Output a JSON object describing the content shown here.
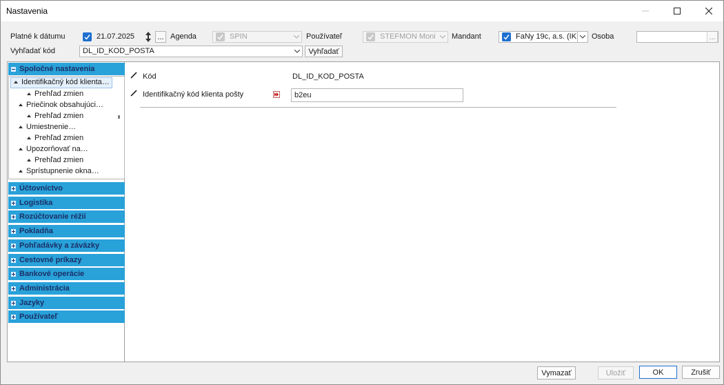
{
  "window": {
    "title": "Nastavenia"
  },
  "filters": {
    "platne_label": "Platné k dátumu",
    "date_value": "21.07.2025",
    "ellipsis": "...",
    "agenda_label": "Agenda",
    "agenda_value": "SPIN",
    "pouzivatel_label": "Používateľ",
    "pouzivatel_value": "STEFMON Moni",
    "mandant_label": "Mandant",
    "mandant_value": "FaNy 19c, a.s. (IK",
    "osoba_label": "Osoba",
    "osoba_value": "",
    "search_label": "Vyhľadať kód",
    "search_value": "DL_ID_KOD_POSTA",
    "search_button": "Vyhľadať"
  },
  "sidebar": {
    "main_group": "Spoločné nastavenia",
    "tree": [
      {
        "label": "Identifikačný kód klienta…",
        "level": 0,
        "selected": true
      },
      {
        "label": "Prehľad zmien",
        "level": 1
      },
      {
        "label": "Priečinok obsahujúci…",
        "level": 0
      },
      {
        "label": "Prehľad zmien",
        "level": 1
      },
      {
        "label": "Umiestnenie…",
        "level": 0
      },
      {
        "label": "Prehľad zmien",
        "level": 1
      },
      {
        "label": "Upozorňovať na…",
        "level": 0
      },
      {
        "label": "Prehľad zmien",
        "level": 1
      },
      {
        "label": "Sprístupnenie okna…",
        "level": 0
      }
    ],
    "groups": [
      "Účtovníctvo",
      "Logistika",
      "Rozúčtovanie réžií",
      "Pokladňa",
      "Pohľadávky a záväzky",
      "Cestovné príkazy",
      "Bankové operácie",
      "Administrácia",
      "Jazyky",
      "Používateľ"
    ]
  },
  "detail": {
    "kod_label": "Kód",
    "kod_value": "DL_ID_KOD_POSTA",
    "ident_label": "Identifikačný kód klienta pošty",
    "ident_value": "b2eu"
  },
  "buttons": {
    "vymazat": "Vymazať",
    "ulozit": "Uložiť",
    "ok": "OK",
    "zrusit": "Zrušiť"
  },
  "colors": {
    "group_bg": "#29a1d9",
    "group_text": "#1b2f66",
    "checkbox": "#1e6fd0"
  }
}
